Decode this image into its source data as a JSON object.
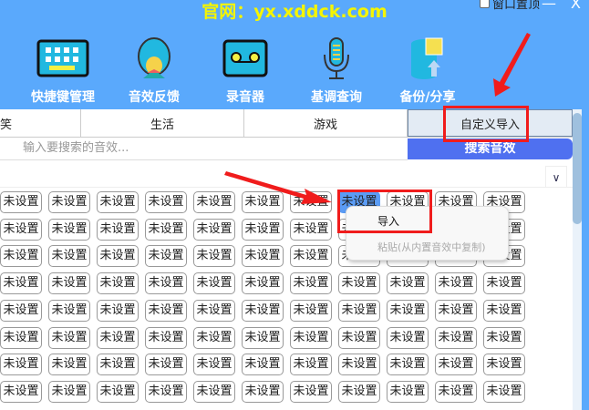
{
  "header": {
    "site": "官网：yx.xddck.com",
    "pin_label": "窗口置顶",
    "minimize": "—",
    "close": "X"
  },
  "toolbar": [
    {
      "label": "快捷键管理",
      "icon": "keyboard-icon"
    },
    {
      "label": "音效反馈",
      "icon": "feedback-icon"
    },
    {
      "label": "录音器",
      "icon": "recorder-icon"
    },
    {
      "label": "基调查询",
      "icon": "microphone-icon"
    },
    {
      "label": "备份/分享",
      "icon": "backup-icon"
    }
  ],
  "tabs": [
    {
      "label": "笑"
    },
    {
      "label": "生活"
    },
    {
      "label": "游戏"
    },
    {
      "label": "自定义导入",
      "selected": true
    }
  ],
  "search": {
    "placeholder": "输入要搜索的音效...",
    "button": "搜索音效"
  },
  "grid": {
    "cell_label": "未设置",
    "rows": 8,
    "cols": 11,
    "highlighted": [
      0,
      7
    ]
  },
  "context_menu": {
    "items": [
      {
        "label": "导入"
      },
      {
        "label": "粘贴(从内置音效中复制)"
      }
    ]
  },
  "colors": {
    "header": "#5aa9fc",
    "site": "#f5f500",
    "search_button": "#4f70f0",
    "annotation": "#f01c1c"
  }
}
